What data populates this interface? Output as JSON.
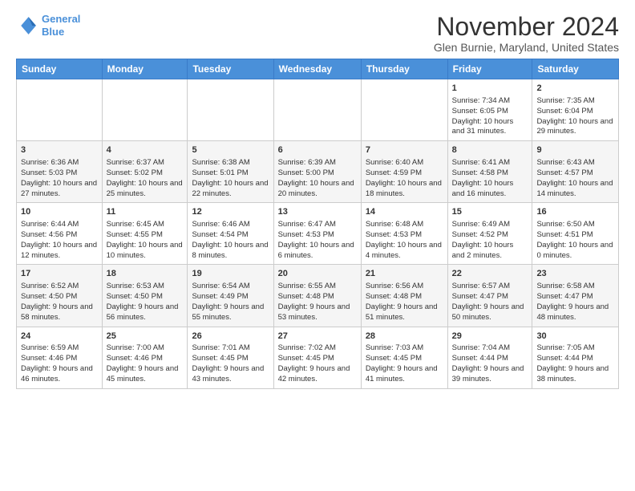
{
  "header": {
    "logo_line1": "General",
    "logo_line2": "Blue",
    "title": "November 2024",
    "subtitle": "Glen Burnie, Maryland, United States"
  },
  "days_of_week": [
    "Sunday",
    "Monday",
    "Tuesday",
    "Wednesday",
    "Thursday",
    "Friday",
    "Saturday"
  ],
  "weeks": [
    [
      {
        "day": "",
        "info": ""
      },
      {
        "day": "",
        "info": ""
      },
      {
        "day": "",
        "info": ""
      },
      {
        "day": "",
        "info": ""
      },
      {
        "day": "",
        "info": ""
      },
      {
        "day": "1",
        "info": "Sunrise: 7:34 AM\nSunset: 6:05 PM\nDaylight: 10 hours and 31 minutes."
      },
      {
        "day": "2",
        "info": "Sunrise: 7:35 AM\nSunset: 6:04 PM\nDaylight: 10 hours and 29 minutes."
      }
    ],
    [
      {
        "day": "3",
        "info": "Sunrise: 6:36 AM\nSunset: 5:03 PM\nDaylight: 10 hours and 27 minutes."
      },
      {
        "day": "4",
        "info": "Sunrise: 6:37 AM\nSunset: 5:02 PM\nDaylight: 10 hours and 25 minutes."
      },
      {
        "day": "5",
        "info": "Sunrise: 6:38 AM\nSunset: 5:01 PM\nDaylight: 10 hours and 22 minutes."
      },
      {
        "day": "6",
        "info": "Sunrise: 6:39 AM\nSunset: 5:00 PM\nDaylight: 10 hours and 20 minutes."
      },
      {
        "day": "7",
        "info": "Sunrise: 6:40 AM\nSunset: 4:59 PM\nDaylight: 10 hours and 18 minutes."
      },
      {
        "day": "8",
        "info": "Sunrise: 6:41 AM\nSunset: 4:58 PM\nDaylight: 10 hours and 16 minutes."
      },
      {
        "day": "9",
        "info": "Sunrise: 6:43 AM\nSunset: 4:57 PM\nDaylight: 10 hours and 14 minutes."
      }
    ],
    [
      {
        "day": "10",
        "info": "Sunrise: 6:44 AM\nSunset: 4:56 PM\nDaylight: 10 hours and 12 minutes."
      },
      {
        "day": "11",
        "info": "Sunrise: 6:45 AM\nSunset: 4:55 PM\nDaylight: 10 hours and 10 minutes."
      },
      {
        "day": "12",
        "info": "Sunrise: 6:46 AM\nSunset: 4:54 PM\nDaylight: 10 hours and 8 minutes."
      },
      {
        "day": "13",
        "info": "Sunrise: 6:47 AM\nSunset: 4:53 PM\nDaylight: 10 hours and 6 minutes."
      },
      {
        "day": "14",
        "info": "Sunrise: 6:48 AM\nSunset: 4:53 PM\nDaylight: 10 hours and 4 minutes."
      },
      {
        "day": "15",
        "info": "Sunrise: 6:49 AM\nSunset: 4:52 PM\nDaylight: 10 hours and 2 minutes."
      },
      {
        "day": "16",
        "info": "Sunrise: 6:50 AM\nSunset: 4:51 PM\nDaylight: 10 hours and 0 minutes."
      }
    ],
    [
      {
        "day": "17",
        "info": "Sunrise: 6:52 AM\nSunset: 4:50 PM\nDaylight: 9 hours and 58 minutes."
      },
      {
        "day": "18",
        "info": "Sunrise: 6:53 AM\nSunset: 4:50 PM\nDaylight: 9 hours and 56 minutes."
      },
      {
        "day": "19",
        "info": "Sunrise: 6:54 AM\nSunset: 4:49 PM\nDaylight: 9 hours and 55 minutes."
      },
      {
        "day": "20",
        "info": "Sunrise: 6:55 AM\nSunset: 4:48 PM\nDaylight: 9 hours and 53 minutes."
      },
      {
        "day": "21",
        "info": "Sunrise: 6:56 AM\nSunset: 4:48 PM\nDaylight: 9 hours and 51 minutes."
      },
      {
        "day": "22",
        "info": "Sunrise: 6:57 AM\nSunset: 4:47 PM\nDaylight: 9 hours and 50 minutes."
      },
      {
        "day": "23",
        "info": "Sunrise: 6:58 AM\nSunset: 4:47 PM\nDaylight: 9 hours and 48 minutes."
      }
    ],
    [
      {
        "day": "24",
        "info": "Sunrise: 6:59 AM\nSunset: 4:46 PM\nDaylight: 9 hours and 46 minutes."
      },
      {
        "day": "25",
        "info": "Sunrise: 7:00 AM\nSunset: 4:46 PM\nDaylight: 9 hours and 45 minutes."
      },
      {
        "day": "26",
        "info": "Sunrise: 7:01 AM\nSunset: 4:45 PM\nDaylight: 9 hours and 43 minutes."
      },
      {
        "day": "27",
        "info": "Sunrise: 7:02 AM\nSunset: 4:45 PM\nDaylight: 9 hours and 42 minutes."
      },
      {
        "day": "28",
        "info": "Sunrise: 7:03 AM\nSunset: 4:45 PM\nDaylight: 9 hours and 41 minutes."
      },
      {
        "day": "29",
        "info": "Sunrise: 7:04 AM\nSunset: 4:44 PM\nDaylight: 9 hours and 39 minutes."
      },
      {
        "day": "30",
        "info": "Sunrise: 7:05 AM\nSunset: 4:44 PM\nDaylight: 9 hours and 38 minutes."
      }
    ]
  ]
}
